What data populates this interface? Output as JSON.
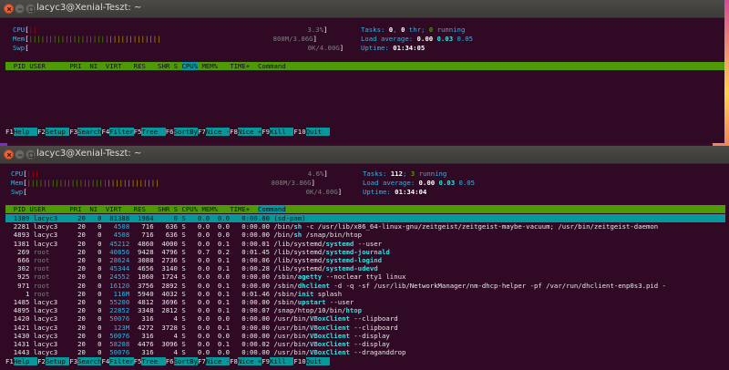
{
  "windows": [
    {
      "title": "lacyc3@Xenial-Teszt: ~",
      "meters": {
        "cpu": {
          "label": "CPU",
          "bar": "||",
          "value": "3.3%"
        },
        "mem": {
          "label": "Mem",
          "bar": "|||||||||||||||||||||||||||||||||",
          "value": "808M/3.86G"
        },
        "swp": {
          "label": "Swp",
          "bar": "",
          "value": "0K/4.00G"
        }
      },
      "stats": {
        "tasks_label": "Tasks:",
        "tasks": "0",
        "thr_label": ",",
        "thr": "0",
        "thr_suffix": "thr;",
        "running": "0",
        "running_label": "running",
        "load_label": "Load average:",
        "load1": "0.00",
        "load5": "0.03",
        "load15": "0.05",
        "uptime_label": "Uptime:",
        "uptime": "01:34:05"
      },
      "columns": [
        "PID",
        "USER",
        "PRI",
        "NI",
        "VIRT",
        "RES",
        "SHR",
        "S",
        "CPU%",
        "MEM%",
        "TIME+",
        "Command"
      ],
      "sorted_column": "CPU%",
      "processes": []
    },
    {
      "title": "lacyc3@Xenial-Teszt: ~",
      "meters": {
        "cpu": {
          "label": "CPU",
          "bar": "|||",
          "value": "4.6%"
        },
        "mem": {
          "label": "Mem",
          "bar": "|||||||||||||||||||||||||||||||||",
          "value": "808M/3.86G"
        },
        "swp": {
          "label": "Swp",
          "bar": "",
          "value": "0K/4.00G"
        }
      },
      "stats": {
        "tasks_label": "Tasks:",
        "tasks": "112",
        "running": "3",
        "running_label": "running",
        "load_label": "Load average:",
        "load1": "0.00",
        "load5": "0.03",
        "load15": "0.05",
        "uptime_label": "Uptime:",
        "uptime": "01:34:04"
      },
      "columns": [
        "PID",
        "USER",
        "PRI",
        "NI",
        "VIRT",
        "RES",
        "SHR",
        "S",
        "CPU%",
        "MEM%",
        "TIME+",
        "Command"
      ],
      "sorted_column": "Command",
      "processes": [
        {
          "pid": "1389",
          "user": "lacyc3",
          "pri": "20",
          "ni": "0",
          "virt": "81388",
          "res": "1984",
          "shr": "0",
          "s": "S",
          "cpu": "0.0",
          "mem": "0.0",
          "time": "0:00.00",
          "path": "",
          "cmd": "(sd-pam)",
          "args": "",
          "selected": true
        },
        {
          "pid": "2281",
          "user": "lacyc3",
          "pri": "20",
          "ni": "0",
          "virt": "4508",
          "res": "716",
          "shr": "636",
          "s": "S",
          "cpu": "0.0",
          "mem": "0.0",
          "time": "0:00.00",
          "path": "/bin/",
          "cmd": "sh",
          "args": " -c /usr/lib/x86_64-linux-gnu/zeitgeist/zeitgeist-maybe-vacuum; /usr/bin/zeitgeist-daemon"
        },
        {
          "pid": "4893",
          "user": "lacyc3",
          "pri": "20",
          "ni": "0",
          "virt": "4508",
          "res": "716",
          "shr": "636",
          "s": "S",
          "cpu": "0.0",
          "mem": "0.0",
          "time": "0:00.00",
          "path": "/bin/",
          "cmd": "sh",
          "args": " /snap/bin/htop"
        },
        {
          "pid": "1381",
          "user": "lacyc3",
          "pri": "20",
          "ni": "0",
          "virt": "45212",
          "res": "4860",
          "shr": "4000",
          "s": "S",
          "cpu": "0.0",
          "mem": "0.1",
          "time": "0:00.01",
          "path": "/lib/systemd/",
          "cmd": "systemd",
          "args": " --user"
        },
        {
          "pid": "269",
          "user": "root",
          "pri": "20",
          "ni": "0",
          "virt": "40856",
          "res": "9428",
          "shr": "4796",
          "s": "S",
          "cpu": "0.7",
          "mem": "0.2",
          "time": "0:01.45",
          "path": "/lib/systemd/",
          "cmd": "systemd-journald",
          "args": ""
        },
        {
          "pid": "666",
          "user": "root",
          "pri": "20",
          "ni": "0",
          "virt": "28624",
          "res": "3088",
          "shr": "2736",
          "s": "S",
          "cpu": "0.0",
          "mem": "0.1",
          "time": "0:00.06",
          "path": "/lib/systemd/",
          "cmd": "systemd-logind",
          "args": ""
        },
        {
          "pid": "302",
          "user": "root",
          "pri": "20",
          "ni": "0",
          "virt": "45344",
          "res": "4656",
          "shr": "3140",
          "s": "S",
          "cpu": "0.0",
          "mem": "0.1",
          "time": "0:00.28",
          "path": "/lib/systemd/",
          "cmd": "systemd-udevd",
          "args": ""
        },
        {
          "pid": "925",
          "user": "root",
          "pri": "20",
          "ni": "0",
          "virt": "24552",
          "res": "1860",
          "shr": "1724",
          "s": "S",
          "cpu": "0.0",
          "mem": "0.0",
          "time": "0:00.00",
          "path": "/sbin/",
          "cmd": "agetty",
          "args": " --noclear tty1 linux"
        },
        {
          "pid": "971",
          "user": "root",
          "pri": "20",
          "ni": "0",
          "virt": "16120",
          "res": "3756",
          "shr": "2892",
          "s": "S",
          "cpu": "0.0",
          "mem": "0.1",
          "time": "0:00.00",
          "path": "/sbin/",
          "cmd": "dhclient",
          "args": " -d -q -sf /usr/lib/NetworkManager/nm-dhcp-helper -pf /var/run/dhclient-enp0s3.pid -"
        },
        {
          "pid": "1",
          "user": "root",
          "pri": "20",
          "ni": "0",
          "virt": "116M",
          "res": "5940",
          "shr": "4032",
          "s": "S",
          "cpu": "0.0",
          "mem": "0.1",
          "time": "0:01.46",
          "path": "/sbin/",
          "cmd": "init",
          "args": " splash"
        },
        {
          "pid": "1485",
          "user": "lacyc3",
          "pri": "20",
          "ni": "0",
          "virt": "55200",
          "res": "4812",
          "shr": "3696",
          "s": "S",
          "cpu": "0.0",
          "mem": "0.1",
          "time": "0:00.00",
          "path": "/sbin/",
          "cmd": "upstart",
          "args": " --user"
        },
        {
          "pid": "4895",
          "user": "lacyc3",
          "pri": "20",
          "ni": "0",
          "virt": "22852",
          "res": "3348",
          "shr": "2812",
          "s": "S",
          "cpu": "0.0",
          "mem": "0.1",
          "time": "0:00.07",
          "path": "/snap/htop/10/bin/",
          "cmd": "htop",
          "args": ""
        },
        {
          "pid": "1420",
          "user": "lacyc3",
          "pri": "20",
          "ni": "0",
          "virt": "50076",
          "res": "316",
          "shr": "4",
          "s": "S",
          "cpu": "0.0",
          "mem": "0.0",
          "time": "0:00.00",
          "path": "/usr/bin/",
          "cmd": "VBoxClient",
          "args": " --clipboard"
        },
        {
          "pid": "1421",
          "user": "lacyc3",
          "pri": "20",
          "ni": "0",
          "virt": "123M",
          "res": "4272",
          "shr": "3728",
          "s": "S",
          "cpu": "0.0",
          "mem": "0.1",
          "time": "0:00.00",
          "path": "/usr/bin/",
          "cmd": "VBoxClient",
          "args": " --clipboard"
        },
        {
          "pid": "1430",
          "user": "lacyc3",
          "pri": "20",
          "ni": "0",
          "virt": "50076",
          "res": "316",
          "shr": "4",
          "s": "S",
          "cpu": "0.0",
          "mem": "0.0",
          "time": "0:00.00",
          "path": "/usr/bin/",
          "cmd": "VBoxClient",
          "args": " --display"
        },
        {
          "pid": "1431",
          "user": "lacyc3",
          "pri": "20",
          "ni": "0",
          "virt": "58208",
          "res": "4476",
          "shr": "3096",
          "s": "S",
          "cpu": "0.0",
          "mem": "0.1",
          "time": "0:00.02",
          "path": "/usr/bin/",
          "cmd": "VBoxClient",
          "args": " --display"
        },
        {
          "pid": "1443",
          "user": "lacyc3",
          "pri": "20",
          "ni": "0",
          "virt": "50076",
          "res": "316",
          "shr": "4",
          "s": "S",
          "cpu": "0.0",
          "mem": "0.0",
          "time": "0:00.00",
          "path": "/usr/bin/",
          "cmd": "VBoxClient",
          "args": " --draganddrop"
        }
      ]
    }
  ],
  "fkeys": [
    {
      "key": "F1",
      "label": "Help  "
    },
    {
      "key": "F2",
      "label": "Setup "
    },
    {
      "key": "F3",
      "label": "Search"
    },
    {
      "key": "F4",
      "label": "Filter"
    },
    {
      "key": "F5",
      "label": "Tree  "
    },
    {
      "key": "F6",
      "label": "SortBy"
    },
    {
      "key": "F7",
      "label": "Nice -"
    },
    {
      "key": "F8",
      "label": "Nice +"
    },
    {
      "key": "F9",
      "label": "Kill  "
    },
    {
      "key": "F10",
      "label": "Quit  "
    }
  ],
  "colors": {
    "terminal_bg": "#300a24",
    "header_green": "#4e9a06",
    "selection_cyan": "#06989a",
    "label_blue": "#34b2e4"
  }
}
